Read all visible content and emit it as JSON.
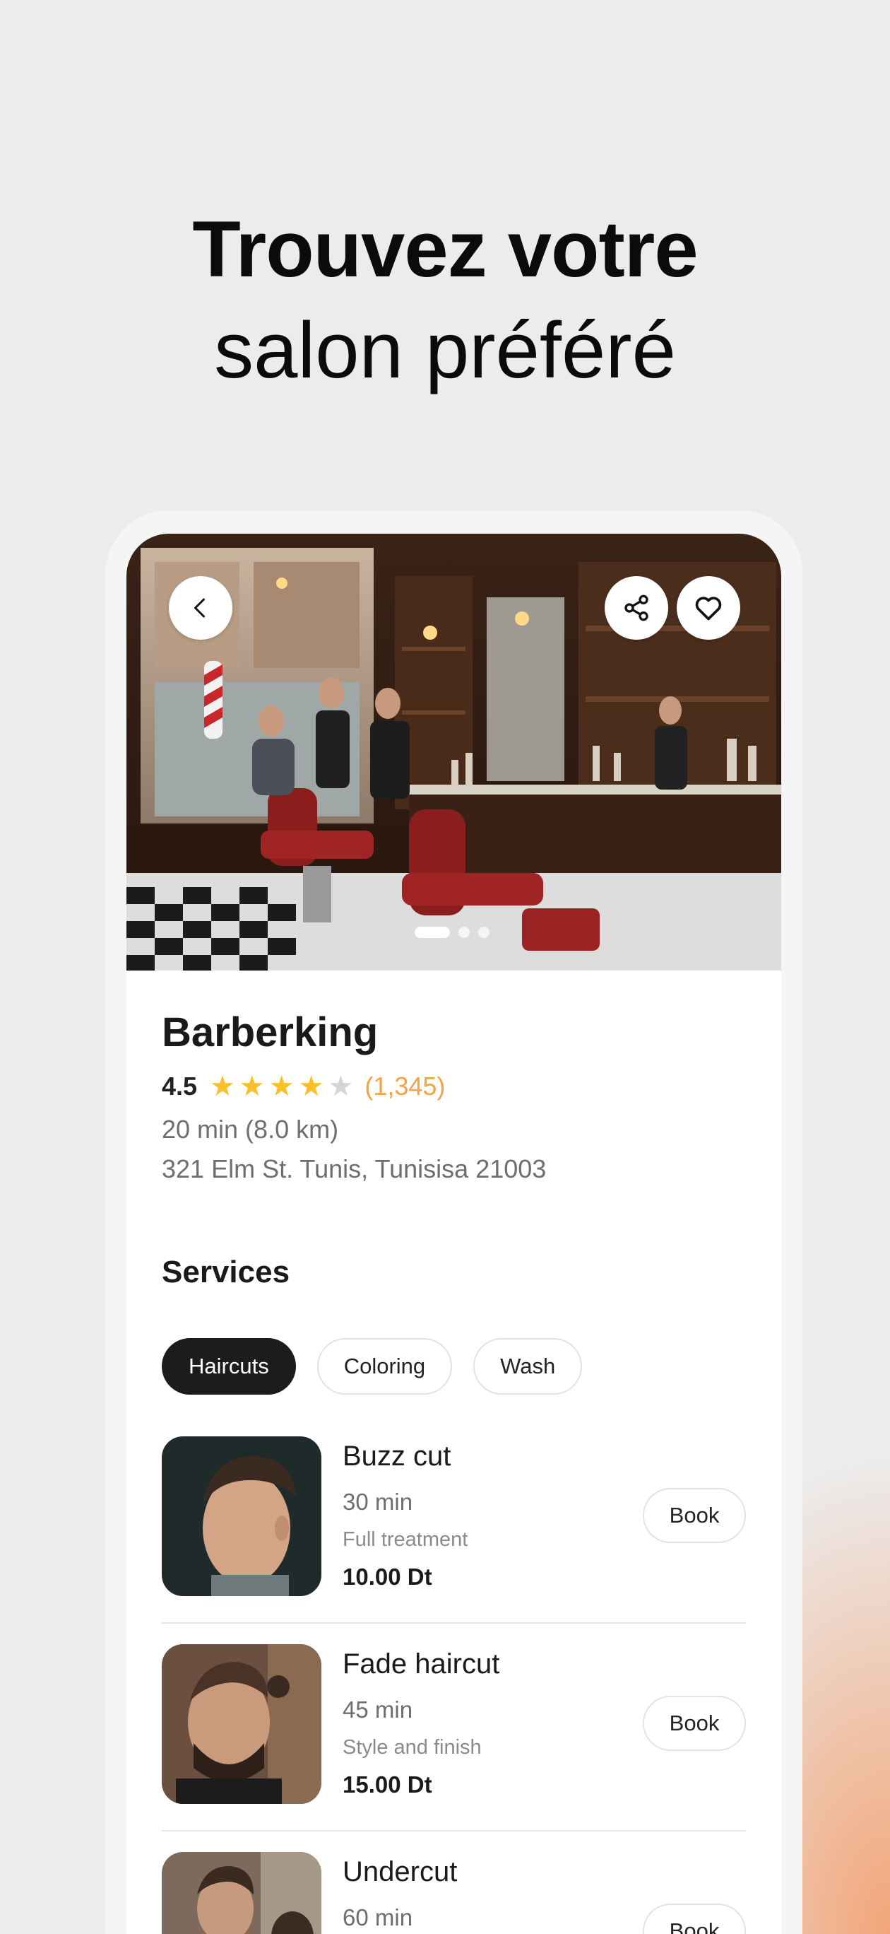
{
  "headline": {
    "line1": "Trouvez votre",
    "line2": "salon préféré"
  },
  "salon": {
    "name": "Barberking",
    "rating": "4.5",
    "stars_filled": 4,
    "stars_total": 5,
    "review_count": "(1,345)",
    "distance": "20 min (8.0 km)",
    "address": "321 Elm St. Tunis, Tunisisa 21003"
  },
  "gallery": {
    "active_index": 0,
    "total": 3
  },
  "services": {
    "title": "Services",
    "tabs": [
      {
        "label": "Haircuts",
        "active": true
      },
      {
        "label": "Coloring",
        "active": false
      },
      {
        "label": "Wash",
        "active": false
      }
    ],
    "items": [
      {
        "name": "Buzz cut",
        "duration": "30 min",
        "description": "Full treatment",
        "price": "10.00 Dt",
        "action": "Book"
      },
      {
        "name": "Fade haircut",
        "duration": "45 min",
        "description": "Style and finish",
        "price": "15.00 Dt",
        "action": "Book"
      },
      {
        "name": "Undercut",
        "duration": "60 min",
        "description": "",
        "price": "",
        "action": "Book"
      }
    ]
  },
  "colors": {
    "accent": "#f4a340",
    "star": "#f9c02a",
    "star_empty": "#d4d4d4",
    "chip_active": "#1c1c1c"
  },
  "icons": {
    "back": "chevron-left-icon",
    "share": "share-icon",
    "favorite": "heart-icon"
  }
}
